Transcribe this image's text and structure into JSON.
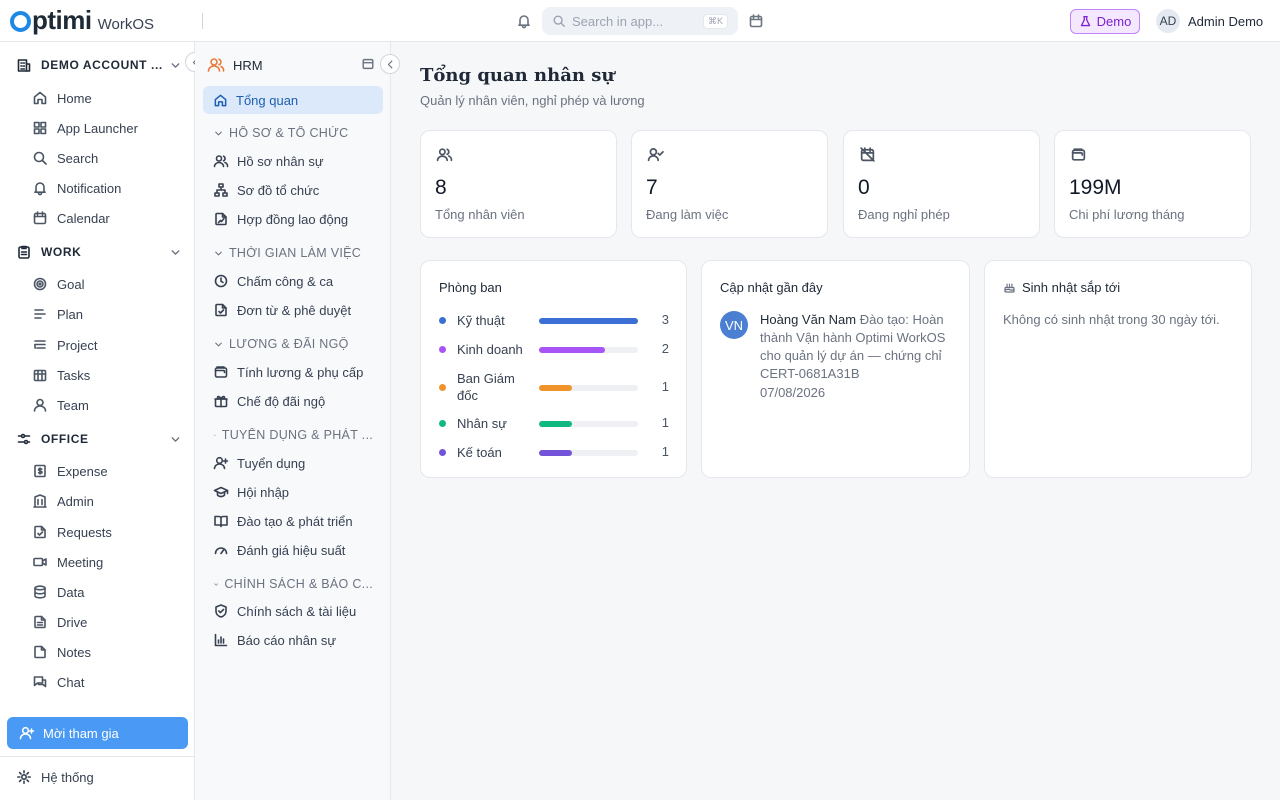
{
  "topbar": {
    "logo_text": "ptimi",
    "logo_sub": "WorkOS",
    "search_placeholder": "Search in app...",
    "search_shortcut": "⌘K",
    "demo_label": "Demo",
    "user_initials": "AD",
    "user_name": "Admin Demo"
  },
  "sidebar": {
    "account_label": "DEMO ACCOUNT ...",
    "top_items": [
      {
        "label": "Home",
        "icon": "home-icon"
      },
      {
        "label": "App Launcher",
        "icon": "grid-icon"
      },
      {
        "label": "Search",
        "icon": "search-icon"
      },
      {
        "label": "Notification",
        "icon": "bell-icon"
      },
      {
        "label": "Calendar",
        "icon": "calendar-icon"
      }
    ],
    "work_label": "WORK",
    "work_items": [
      {
        "label": "Goal",
        "icon": "target-icon"
      },
      {
        "label": "Plan",
        "icon": "plan-icon"
      },
      {
        "label": "Project",
        "icon": "project-icon"
      },
      {
        "label": "Tasks",
        "icon": "tasks-icon"
      },
      {
        "label": "Team",
        "icon": "user-icon"
      }
    ],
    "office_label": "OFFICE",
    "office_items": [
      {
        "label": "Expense",
        "icon": "receipt-icon"
      },
      {
        "label": "Admin",
        "icon": "building-icon"
      },
      {
        "label": "Requests",
        "icon": "request-icon"
      },
      {
        "label": "Meeting",
        "icon": "video-icon"
      },
      {
        "label": "Data",
        "icon": "database-icon"
      },
      {
        "label": "Drive",
        "icon": "file-icon"
      },
      {
        "label": "Notes",
        "icon": "note-icon"
      },
      {
        "label": "Chat",
        "icon": "chat-icon"
      }
    ],
    "invite_label": "Mời tham gia",
    "system_label": "Hệ thống"
  },
  "hrm": {
    "title": "HRM",
    "active_item": "Tổng quan",
    "groups": [
      {
        "label": "HỒ SƠ & TỔ CHỨC",
        "items": [
          "Hồ sơ nhân sự",
          "Sơ đồ tổ chức",
          "Hợp đồng lao động"
        ]
      },
      {
        "label": "THỜI GIAN LÀM VIỆC",
        "items": [
          "Chấm công & ca",
          "Đơn từ & phê duyệt"
        ]
      },
      {
        "label": "LƯƠNG & ĐÃI NGỘ",
        "items": [
          "Tính lương & phụ cấp",
          "Chế độ đãi ngộ"
        ]
      },
      {
        "label": "TUYỂN DỤNG & PHÁT ...",
        "items": [
          "Tuyển dụng",
          "Hội nhập",
          "Đào tạo & phát triển",
          "Đánh giá hiệu suất"
        ]
      },
      {
        "label": "CHÍNH SÁCH & BÁO C...",
        "items": [
          "Chính sách & tài liệu",
          "Báo cáo nhân sự"
        ]
      }
    ]
  },
  "main": {
    "title": "Tổng quan nhân sự",
    "subtitle": "Quản lý nhân viên, nghỉ phép và lương",
    "stats": [
      {
        "value": "8",
        "label": "Tổng nhân viên",
        "icon": "users-icon"
      },
      {
        "value": "7",
        "label": "Đang làm việc",
        "icon": "user-check-icon"
      },
      {
        "value": "0",
        "label": "Đang nghỉ phép",
        "icon": "calendar-off-icon"
      },
      {
        "value": "199M",
        "label": "Chi phí lương tháng",
        "icon": "wallet-icon"
      }
    ],
    "departments": {
      "title": "Phòng ban",
      "max": 3,
      "items": [
        {
          "name": "Kỹ thuật",
          "count": 3,
          "color": "#3b6fd4"
        },
        {
          "name": "Kinh doanh",
          "count": 2,
          "color": "#a855f7"
        },
        {
          "name": "Ban Giám đốc",
          "count": 1,
          "color": "#f0932b"
        },
        {
          "name": "Nhân sự",
          "count": 1,
          "color": "#10b981"
        },
        {
          "name": "Kế toán",
          "count": 1,
          "color": "#7353d8"
        }
      ]
    },
    "updates": {
      "title": "Cập nhật gần đây",
      "avatar": "VN",
      "name": "Hoàng Văn Nam",
      "text": "Đào tạo: Hoàn thành Vận hành Optimi WorkOS cho quản lý dự án — chứng chỉ CERT-0681A31B",
      "date": "07/08/2026"
    },
    "birthdays": {
      "title": "Sinh nhật sắp tới",
      "empty": "Không có sinh nhật trong 30 ngày tới."
    }
  }
}
